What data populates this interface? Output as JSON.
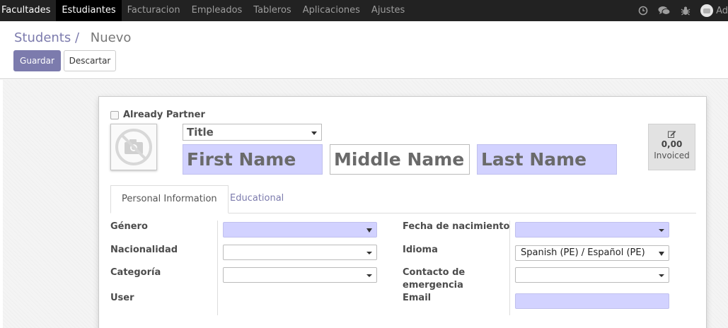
{
  "nav": {
    "items": [
      {
        "label": "Facultades"
      },
      {
        "label": "Estudiantes"
      },
      {
        "label": "Facturacion"
      },
      {
        "label": "Empleados"
      },
      {
        "label": "Tableros"
      },
      {
        "label": "Aplicaciones"
      },
      {
        "label": "Ajustes"
      }
    ],
    "active_index": 1,
    "icons": [
      "clock-icon",
      "chat-icon",
      "bug-icon"
    ],
    "user_label": "Ad"
  },
  "breadcrumb": {
    "parent": "Students",
    "separator": "/",
    "current": "Nuevo"
  },
  "buttons": {
    "save": "Guardar",
    "discard": "Descartar"
  },
  "form": {
    "already_partner_label": "Already Partner",
    "already_partner_checked": false,
    "title_placeholder": "Title",
    "first_name_placeholder": "First Name",
    "middle_name_placeholder": "Middle Name",
    "last_name_placeholder": "Last Name",
    "invoiced": {
      "value": "0,00",
      "label": "Invoiced"
    }
  },
  "tabs": [
    {
      "label": "Personal Information"
    },
    {
      "label": "Educational"
    }
  ],
  "personal": {
    "genero_label": "Género",
    "genero_value": "",
    "nacionalidad_label": "Nacionalidad",
    "nacionalidad_value": "",
    "categoria_label": "Categoría",
    "categoria_value": "",
    "user_label": "User",
    "fecha_label": "Fecha de nacimiento",
    "fecha_value": "",
    "idioma_label": "Idioma",
    "idioma_value": "Spanish (PE) / Español (PE)",
    "contacto_label_1": "Contacto de",
    "contacto_label_2": "emergencia",
    "contacto_value": "",
    "email_label": "Email",
    "email_value": ""
  },
  "colors": {
    "nav_bg": "#222222",
    "accent": "#7c7bad",
    "required_bg": "#d2d2ff"
  }
}
